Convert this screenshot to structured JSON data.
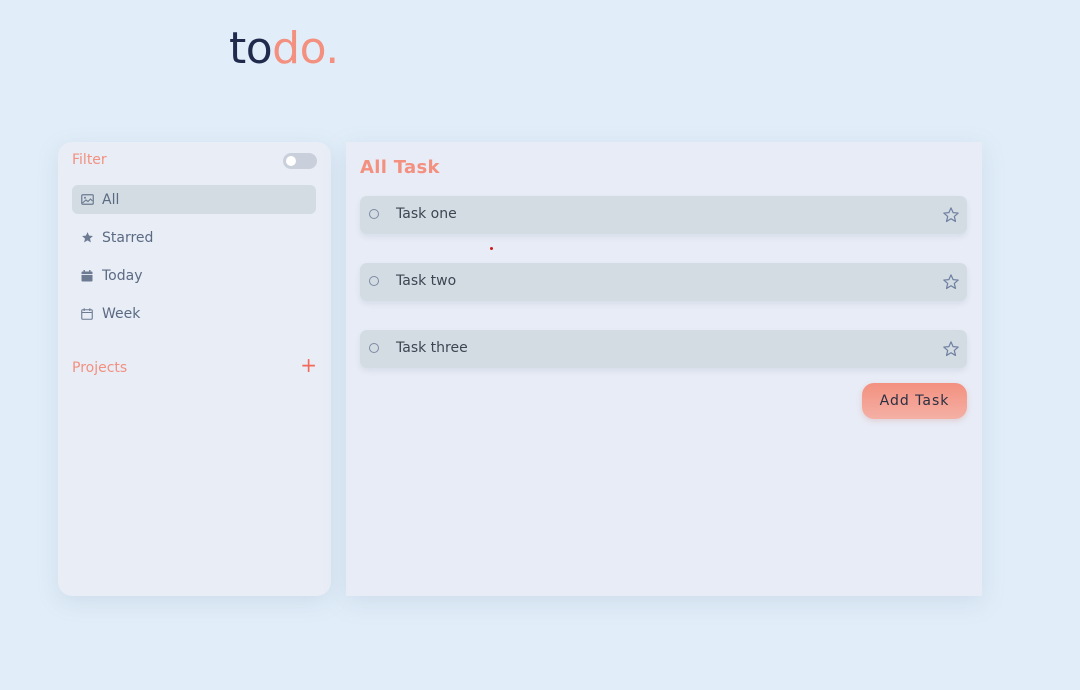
{
  "logo": {
    "part1": "to",
    "part2": "do."
  },
  "sidebar": {
    "filter_title": "Filter",
    "items": [
      {
        "label": "All",
        "icon": "image-icon",
        "active": true
      },
      {
        "label": "Starred",
        "icon": "star-icon",
        "active": false
      },
      {
        "label": "Today",
        "icon": "calendar-filled-icon",
        "active": false
      },
      {
        "label": "Week",
        "icon": "calendar-outline-icon",
        "active": false
      }
    ],
    "projects_title": "Projects",
    "add_project_label": "+"
  },
  "main": {
    "title": "All Task",
    "tasks": [
      {
        "label": "Task one"
      },
      {
        "label": "Task two"
      },
      {
        "label": "Task three"
      }
    ],
    "add_task_label": "Add Task"
  },
  "colors": {
    "background": "#e1eef9",
    "accent": "#f3907f",
    "dark": "#1f2a4d",
    "task_bg": "#d3dce3"
  }
}
